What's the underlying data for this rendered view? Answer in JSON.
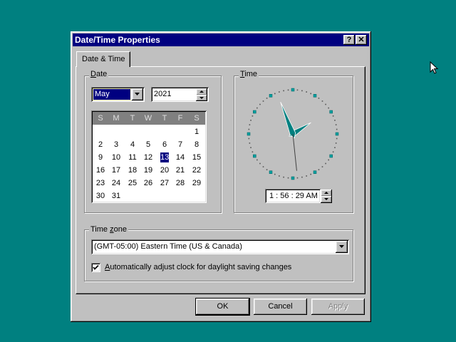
{
  "window": {
    "title": "Date/Time Properties",
    "help_button": "?",
    "close_button": "✕"
  },
  "tabs": [
    {
      "label": "Date & Time",
      "selected": true
    }
  ],
  "date_group": {
    "legend_underlined": "D",
    "legend_rest": "ate",
    "month": "May",
    "year": "2021",
    "weekday_headers": [
      "S",
      "M",
      "T",
      "W",
      "T",
      "F",
      "S"
    ],
    "weeks": [
      [
        "",
        "",
        "",
        "",
        "",
        "",
        "1"
      ],
      [
        "2",
        "3",
        "4",
        "5",
        "6",
        "7",
        "8"
      ],
      [
        "9",
        "10",
        "11",
        "12",
        "13",
        "14",
        "15"
      ],
      [
        "16",
        "17",
        "18",
        "19",
        "20",
        "21",
        "22"
      ],
      [
        "23",
        "24",
        "25",
        "26",
        "27",
        "28",
        "29"
      ],
      [
        "30",
        "31",
        "",
        "",
        "",
        "",
        ""
      ]
    ],
    "selected_day": "13"
  },
  "time_group": {
    "legend_underlined": "T",
    "legend_rest": "ime",
    "time_value": "1 : 56 : 29 AM",
    "clock": {
      "hours": 1,
      "minutes": 56,
      "seconds": 29
    }
  },
  "timezone_group": {
    "legend_prefix": "Time ",
    "legend_underlined": "z",
    "legend_rest": "one",
    "selected": "(GMT-05:00) Eastern Time (US & Canada)",
    "dst_checkbox": {
      "checked": true,
      "label_underlined": "A",
      "label_rest": "utomatically adjust clock for daylight saving changes"
    }
  },
  "buttons": {
    "ok": "OK",
    "cancel": "Cancel",
    "apply": "Apply",
    "apply_enabled": false
  },
  "colors": {
    "desktop": "#008080",
    "titlebar": "#000080",
    "face": "#c0c0c0",
    "clock_hands": "#008080",
    "clock_markers": "#00a0a0"
  }
}
